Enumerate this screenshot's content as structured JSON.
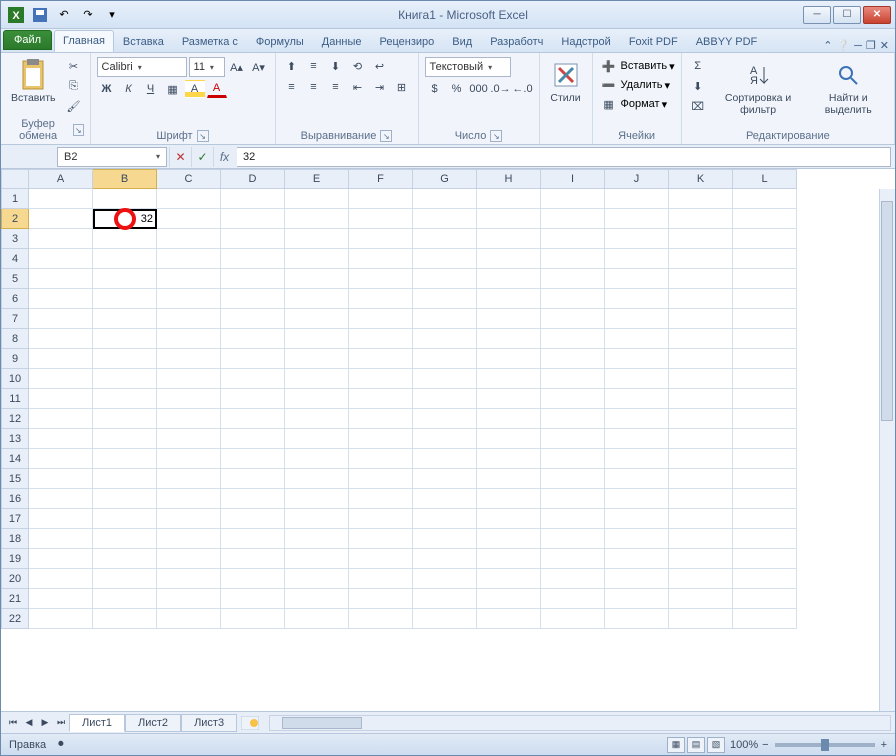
{
  "title": "Книга1 - Microsoft Excel",
  "tabs": {
    "file": "Файл",
    "home": "Главная",
    "t2": "Вставка",
    "t3": "Разметка с",
    "t4": "Формулы",
    "t5": "Данные",
    "t6": "Рецензиро",
    "t7": "Вид",
    "t8": "Разработч",
    "t9": "Надстрой",
    "t10": "Foxit PDF",
    "t11": "ABBYY PDF"
  },
  "ribbon": {
    "clipboard": {
      "paste": "Вставить",
      "label": "Буфер обмена"
    },
    "font": {
      "name": "Calibri",
      "size": "11",
      "bold": "Ж",
      "italic": "К",
      "under": "Ч",
      "label": "Шрифт"
    },
    "align": {
      "label": "Выравнивание"
    },
    "number": {
      "format": "Текстовый",
      "label": "Число"
    },
    "cells": {
      "styles": "Стили",
      "insert": "Вставить",
      "delete": "Удалить",
      "format": "Формат",
      "label": "Ячейки"
    },
    "editing": {
      "sort": "Сортировка и фильтр",
      "find": "Найти и выделить",
      "label": "Редактирование"
    }
  },
  "formulabar": {
    "name": "B2",
    "fx": "fx",
    "value": "32"
  },
  "columns": [
    "A",
    "B",
    "C",
    "D",
    "E",
    "F",
    "G",
    "H",
    "I",
    "J",
    "K",
    "L"
  ],
  "selected_col": 1,
  "selected_row": 1,
  "row_count": 22,
  "cell_value": "32",
  "sheets": {
    "s1": "Лист1",
    "s2": "Лист2",
    "s3": "Лист3"
  },
  "status": {
    "mode": "Правка",
    "zoom": "100%"
  }
}
